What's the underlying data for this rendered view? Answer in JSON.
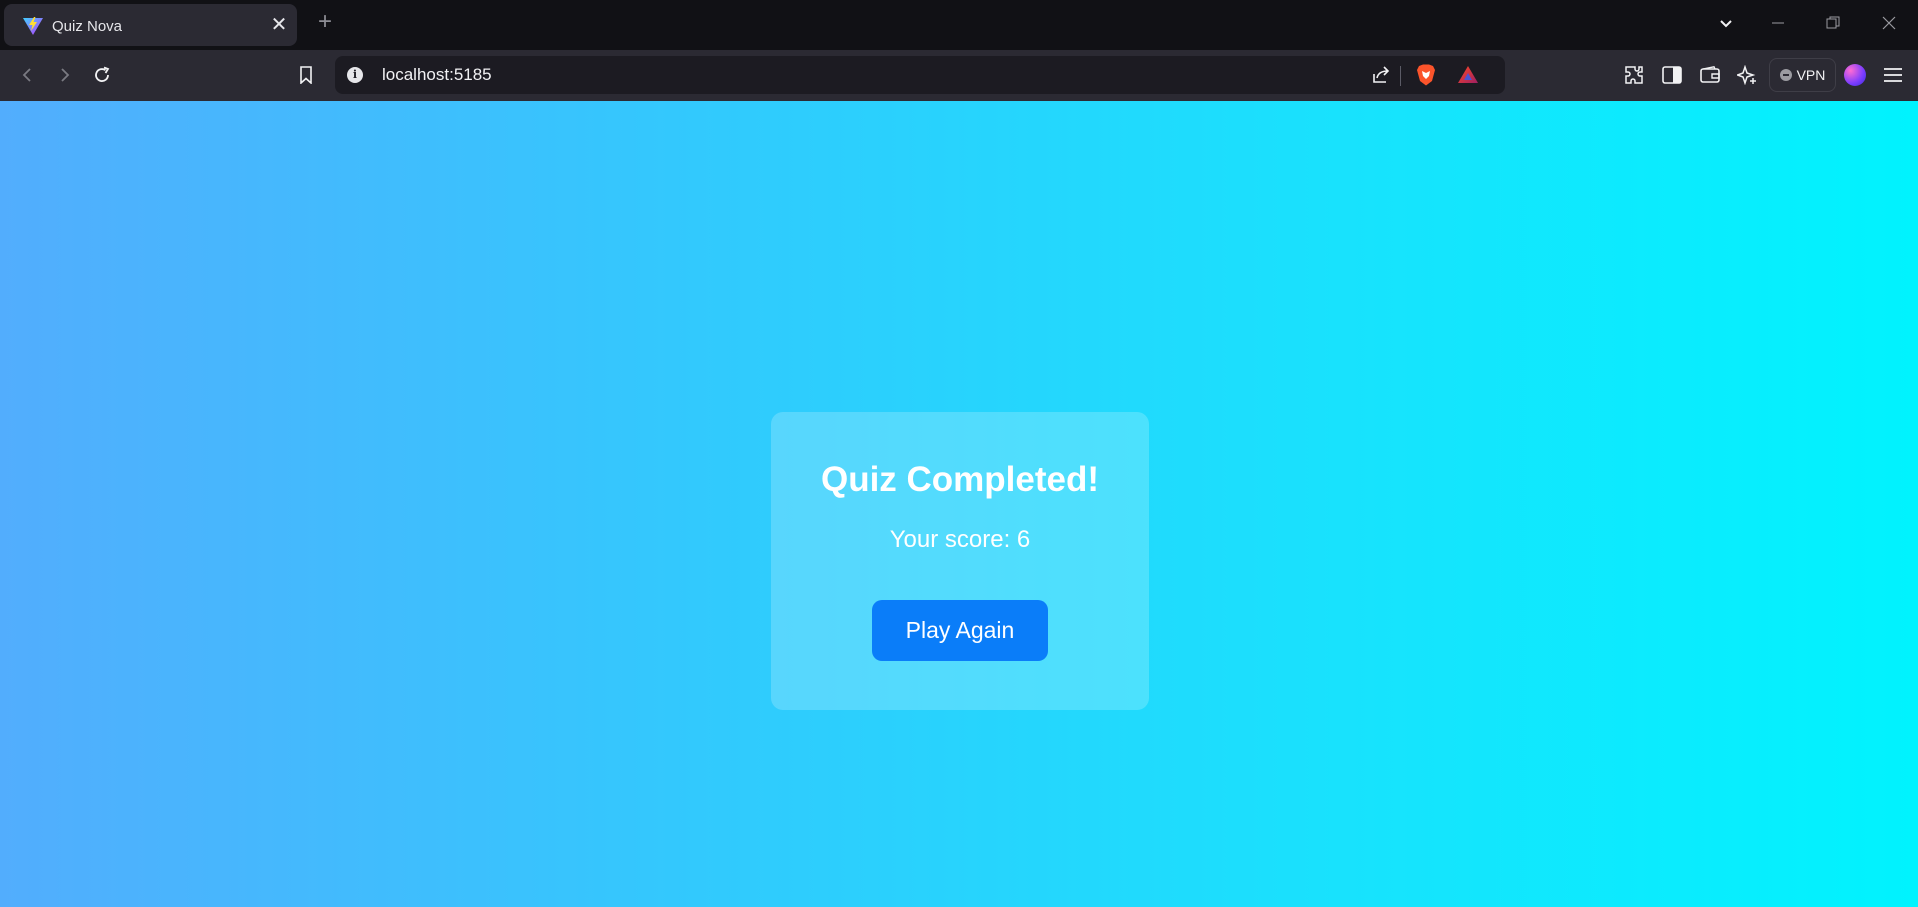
{
  "browser": {
    "tab": {
      "title": "Quiz Nova",
      "close_glyph": "✕",
      "favicon": "vite-logo-icon"
    },
    "new_tab_glyph": "+",
    "address": {
      "url": "localhost:5185"
    },
    "vpn_label": "VPN"
  },
  "quiz_result": {
    "heading": "Quiz Completed!",
    "score_text": "Your score: 6",
    "play_again_label": "Play Again"
  },
  "colors": {
    "gradient_start": "#52adfd",
    "gradient_end": "#00f3fe",
    "button": "#0a7df9",
    "card": "rgba(255,255,255,0.2)"
  }
}
